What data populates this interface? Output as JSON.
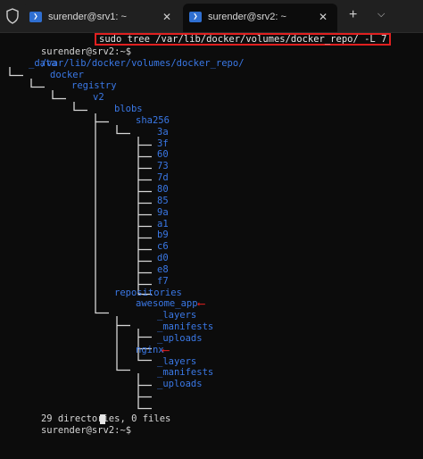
{
  "tabs": [
    {
      "label": "surender@srv1: ~",
      "icon": "powershell-icon"
    },
    {
      "label": "surender@srv2: ~",
      "icon": "powershell-icon"
    }
  ],
  "glyphs": {
    "close": "✕",
    "plus": "+",
    "chevron": "⌵",
    "ps": "❯"
  },
  "terminal": {
    "prompt": "surender@srv2:~$",
    "command": "sudo tree /var/lib/docker/volumes/docker_repo/ -L 7",
    "root_path": "/var/lib/docker/volumes/docker_repo/",
    "tree": {
      "data": "_data",
      "docker": "docker",
      "registry": "registry",
      "v2": "v2",
      "blobs": "blobs",
      "sha256": "sha256",
      "blob_dirs": [
        "3a",
        "3f",
        "60",
        "73",
        "7d",
        "80",
        "85",
        "9a",
        "a1",
        "b9",
        "c6",
        "d0",
        "e8",
        "f7"
      ],
      "repositories": "repositories",
      "awesome_app": "awesome_app",
      "awesome_app_children": [
        "_layers",
        "_manifests",
        "_uploads"
      ],
      "nginx": "nginx",
      "nginx_children": [
        "_layers",
        "_manifests",
        "_uploads"
      ]
    },
    "summary": "29 directories, 0 files",
    "annotation_color": "#e02020"
  }
}
